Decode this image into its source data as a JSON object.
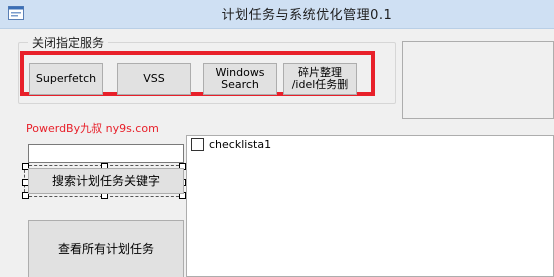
{
  "window": {
    "title": "计划任务与系统优化管理0.1"
  },
  "group": {
    "title": "关闭指定服务"
  },
  "buttons": {
    "superfetch": "Superfetch",
    "vss": "VSS",
    "windows_search": "Windows Search",
    "defrag": "碎片整理 /idel任务删",
    "search_keyword": "搜索计划任务关键字",
    "view_all": "查看所有计划任务"
  },
  "credit": "PowerdBy九叔 ny9s.com",
  "search_input": {
    "value": ""
  },
  "checklist": {
    "items": [
      {
        "label": "checklista1",
        "checked": false
      }
    ]
  },
  "colors": {
    "highlight": "#e8202a",
    "titlebar": "#cfe0f3"
  }
}
